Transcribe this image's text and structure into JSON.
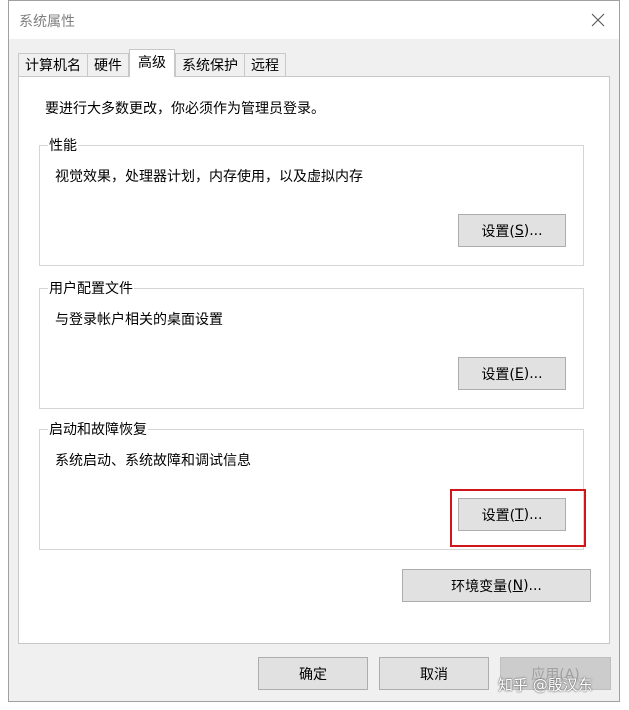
{
  "window": {
    "title": "系统属性",
    "close_icon": "✕"
  },
  "tabs": [
    {
      "label": "计算机名",
      "active": false
    },
    {
      "label": "硬件",
      "active": false
    },
    {
      "label": "高级",
      "active": true
    },
    {
      "label": "系统保护",
      "active": false
    },
    {
      "label": "远程",
      "active": false
    }
  ],
  "panel": {
    "admin_note": "要进行大多数更改，你必须作为管理员登录。",
    "groups": [
      {
        "title": "性能",
        "description": "视觉效果，处理器计划，内存使用，以及虚拟内存",
        "button_text": "设置(",
        "button_key": "S",
        "button_suffix": ")..."
      },
      {
        "title": "用户配置文件",
        "description": "与登录帐户相关的桌面设置",
        "button_text": "设置(",
        "button_key": "E",
        "button_suffix": ")..."
      },
      {
        "title": "启动和故障恢复",
        "description": "系统启动、系统故障和调试信息",
        "button_text": "设置(",
        "button_key": "T",
        "button_suffix": ")..."
      }
    ],
    "env_button": {
      "text": "环境变量(",
      "key": "N",
      "suffix": ")..."
    }
  },
  "footer": {
    "ok": "确定",
    "cancel": "取消",
    "apply": "应用(A)"
  },
  "highlight_color": "#d0161b",
  "watermark": "知乎 @殷汉东"
}
